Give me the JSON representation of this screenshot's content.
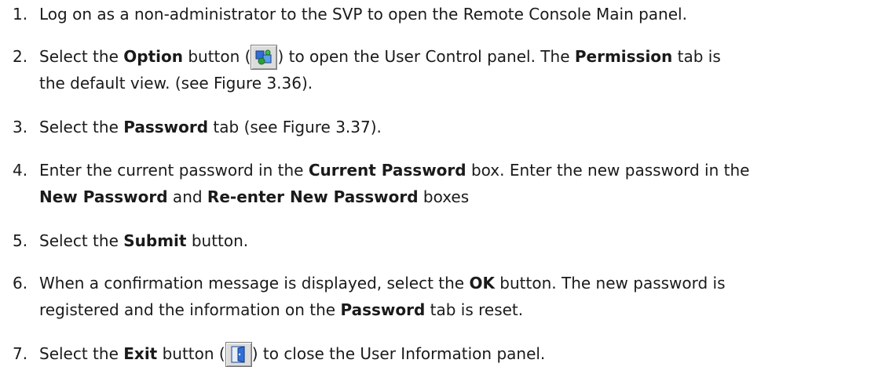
{
  "steps": [
    {
      "num": "1.",
      "parts": [
        "Log on as a non-administrator to the SVP to open the Remote Console Main panel."
      ]
    },
    {
      "num": "2.",
      "parts": [
        "Select the ",
        "Option",
        " button (",
        ") to open the User Control panel. The ",
        "Permission",
        " tab is",
        "the default view. (see Figure 3.36)."
      ]
    },
    {
      "num": "3.",
      "parts": [
        "Select the ",
        "Password",
        " tab (see Figure 3.37)."
      ]
    },
    {
      "num": "4.",
      "parts": [
        "Enter the current password in the ",
        "Current Password",
        " box. Enter the new password in the",
        "New Password",
        " and ",
        "Re-enter New Password",
        " boxes"
      ]
    },
    {
      "num": "5.",
      "parts": [
        "Select the ",
        "Submit",
        " button."
      ]
    },
    {
      "num": "6.",
      "parts": [
        "When a confirmation message is displayed, select the ",
        "OK",
        " button. The new password is",
        "registered and the information on the ",
        "Password",
        " tab is reset."
      ]
    },
    {
      "num": "7.",
      "parts": [
        "Select the ",
        "Exit",
        " button (",
        ") to close the User Information panel."
      ]
    }
  ],
  "icons": {
    "option_icon": "option-network-icon",
    "exit_icon": "exit-door-icon",
    "colors": {
      "icon_blue": "#2f6fd6",
      "icon_green": "#2e9e3a",
      "button_face": "#dcdcdc",
      "text": "#1a1a1a"
    }
  }
}
